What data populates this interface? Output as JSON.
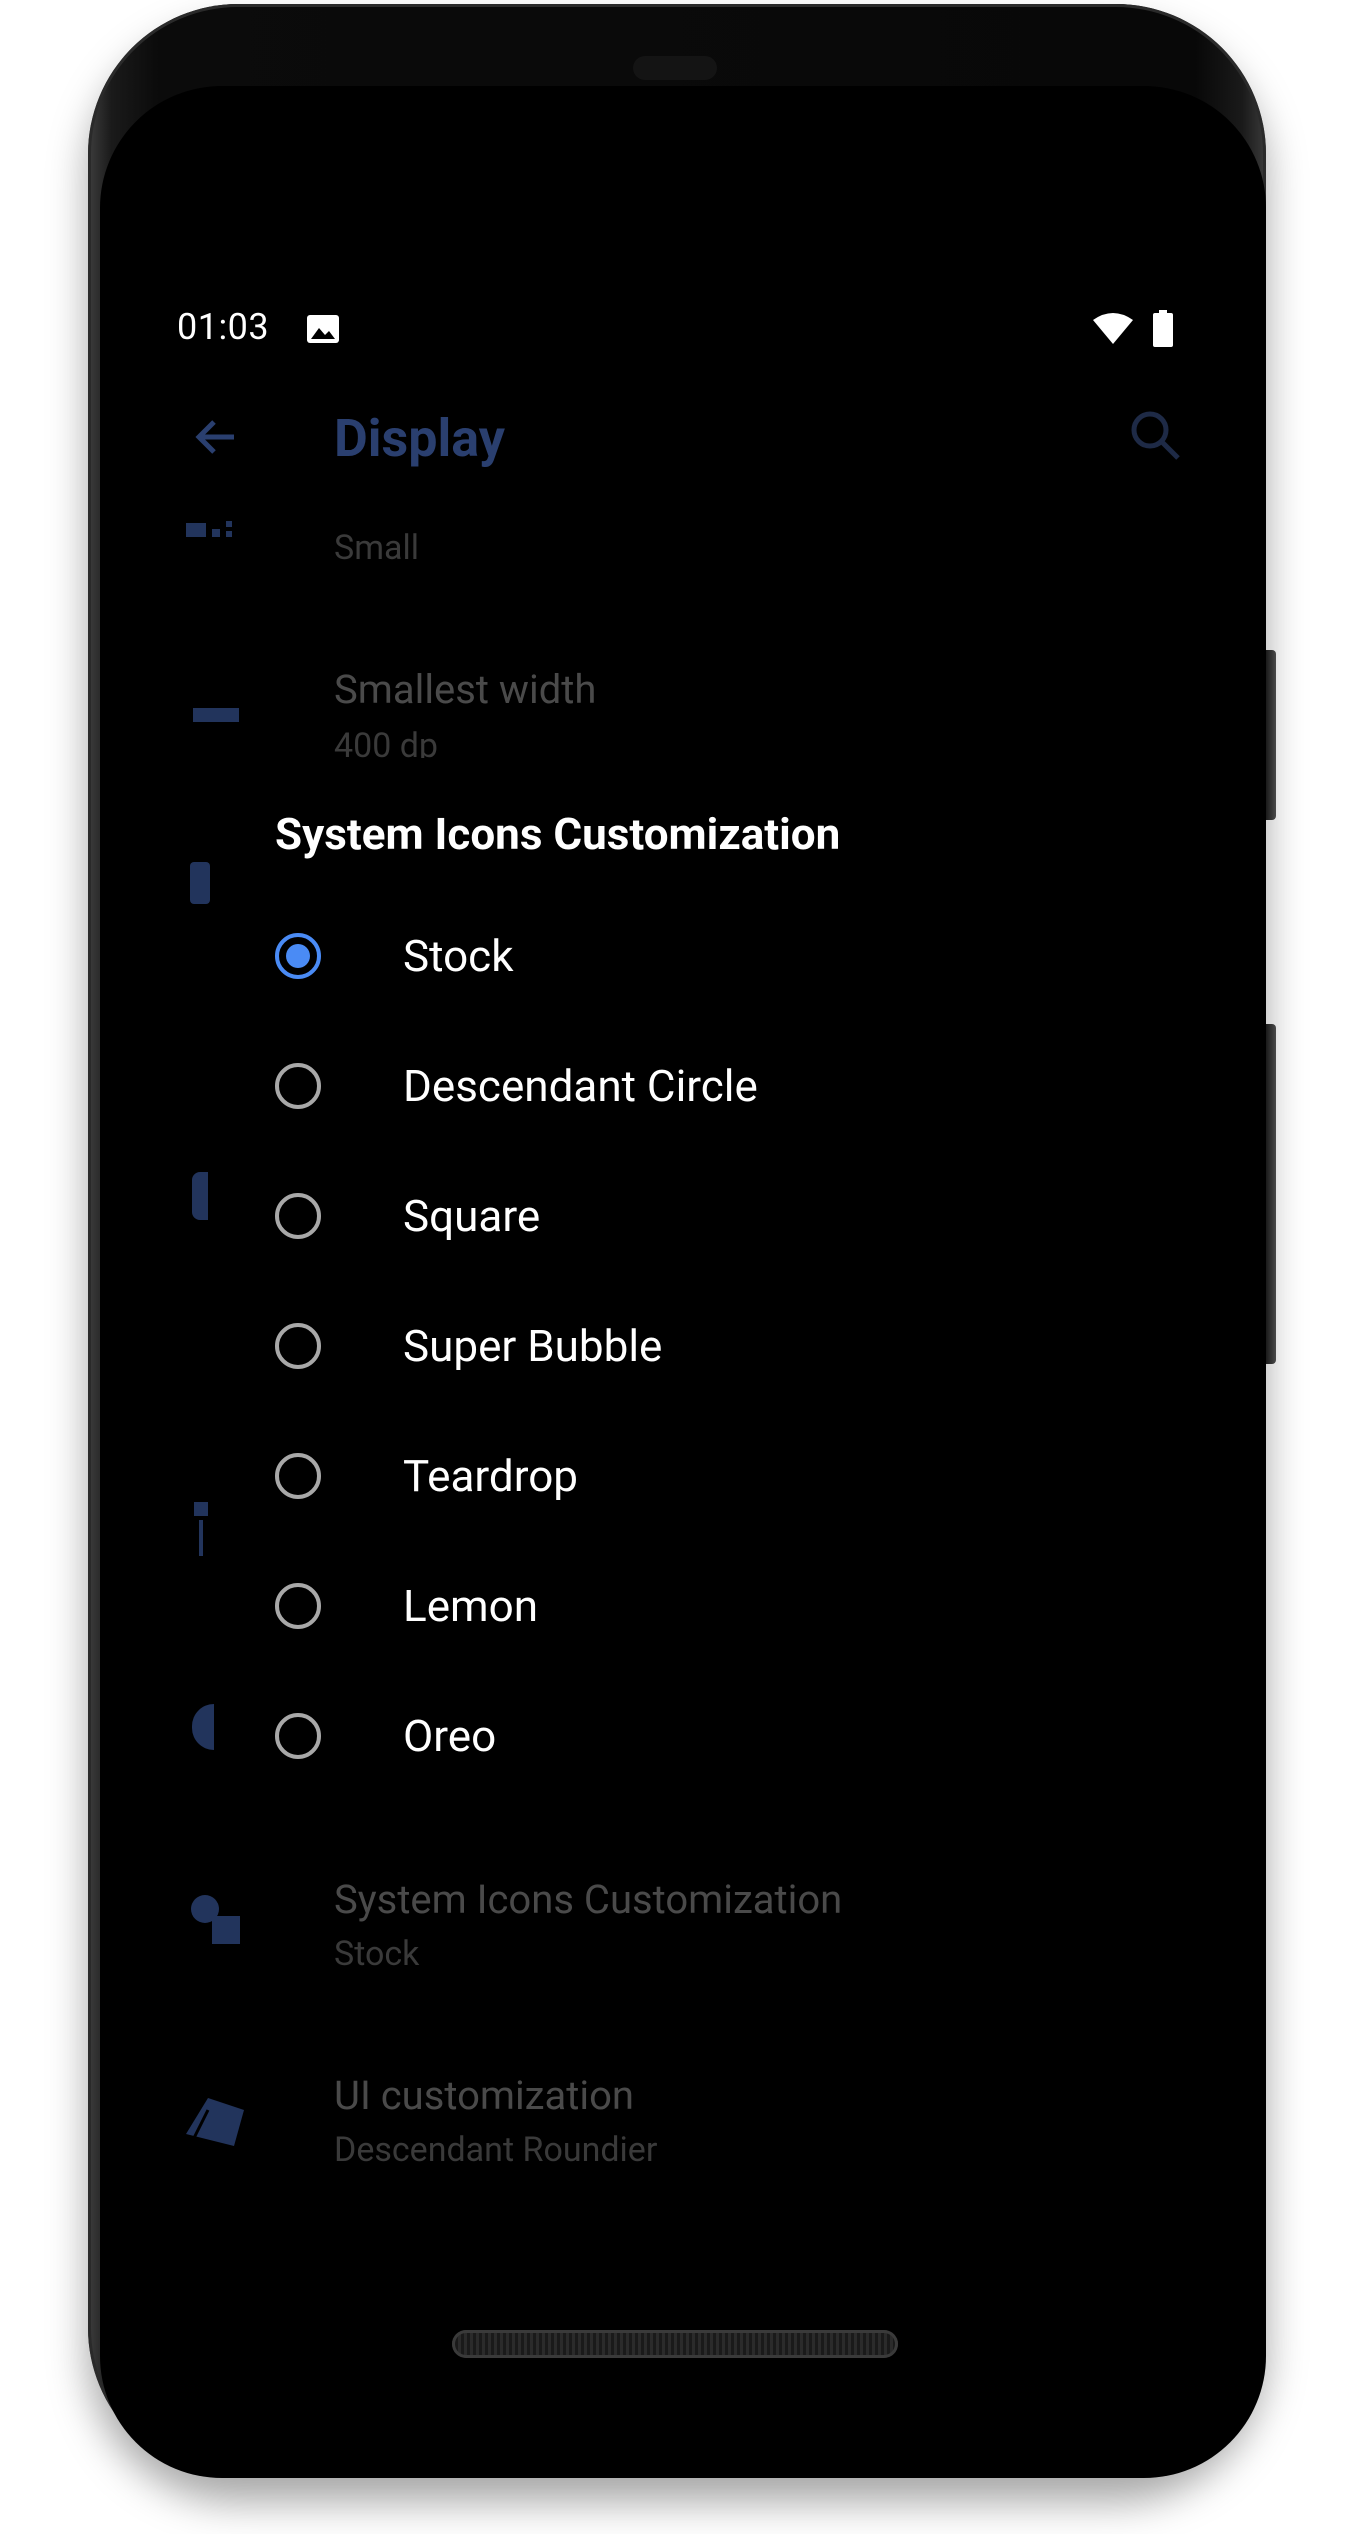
{
  "status_bar": {
    "time": "01:03",
    "icons": [
      "image-icon",
      "wifi-icon",
      "battery-icon"
    ]
  },
  "toolbar": {
    "title": "Display",
    "back_icon": "back-arrow-icon",
    "search_icon": "search-icon"
  },
  "background_settings": [
    {
      "title": "",
      "value": "Small",
      "icon": "display-size-icon"
    },
    {
      "title": "Smallest width",
      "value": "400 dp",
      "icon": "width-icon"
    },
    {
      "title": "System Icons Customization",
      "value": "Stock",
      "icon": "shapes-icon"
    },
    {
      "title": "UI customization",
      "value": "Descendant Roundier",
      "icon": "ui-customization-icon"
    }
  ],
  "dialog": {
    "title": "System Icons Customization",
    "options": [
      "Stock",
      "Descendant Circle",
      "Square",
      "Super Bubble",
      "Teardrop",
      "Lemon",
      "Oreo"
    ],
    "selected": "Stock"
  },
  "colors": {
    "accent": "#4a8bf5",
    "dim_accent": "#2a3f6f",
    "background": "#000000"
  }
}
